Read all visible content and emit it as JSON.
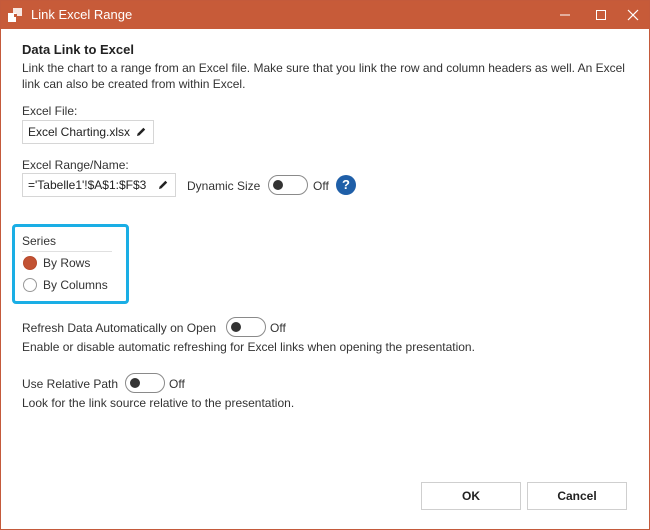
{
  "window": {
    "title": "Link Excel Range"
  },
  "heading": "Data Link to Excel",
  "description": "Link the chart to a range from an Excel file. Make sure that you link the row and column headers as well. An Excel link can also be created from within Excel.",
  "excel_file": {
    "label": "Excel File:",
    "value": "Excel Charting.xlsx"
  },
  "excel_range": {
    "label": "Excel Range/Name:",
    "value": "='Tabelle1'!$A$1:$F$3"
  },
  "dynamic_size": {
    "label": "Dynamic Size",
    "state": "Off"
  },
  "help": {
    "glyph": "?"
  },
  "series": {
    "label": "Series",
    "options": [
      {
        "label": "By Rows",
        "checked": true
      },
      {
        "label": "By Columns",
        "checked": false
      }
    ]
  },
  "refresh": {
    "label": "Refresh Data Automatically on Open",
    "state": "Off",
    "description": "Enable or disable automatic refreshing for Excel links when opening the presentation."
  },
  "relative_path": {
    "label": "Use Relative Path",
    "state": "Off",
    "description": "Look for the link source relative to the presentation."
  },
  "buttons": {
    "ok": "OK",
    "cancel": "Cancel"
  },
  "colors": {
    "titlebar": "#c75b39",
    "accent_radio": "#c25233",
    "focus_border": "#1aaee5",
    "help": "#1f5fa8"
  }
}
